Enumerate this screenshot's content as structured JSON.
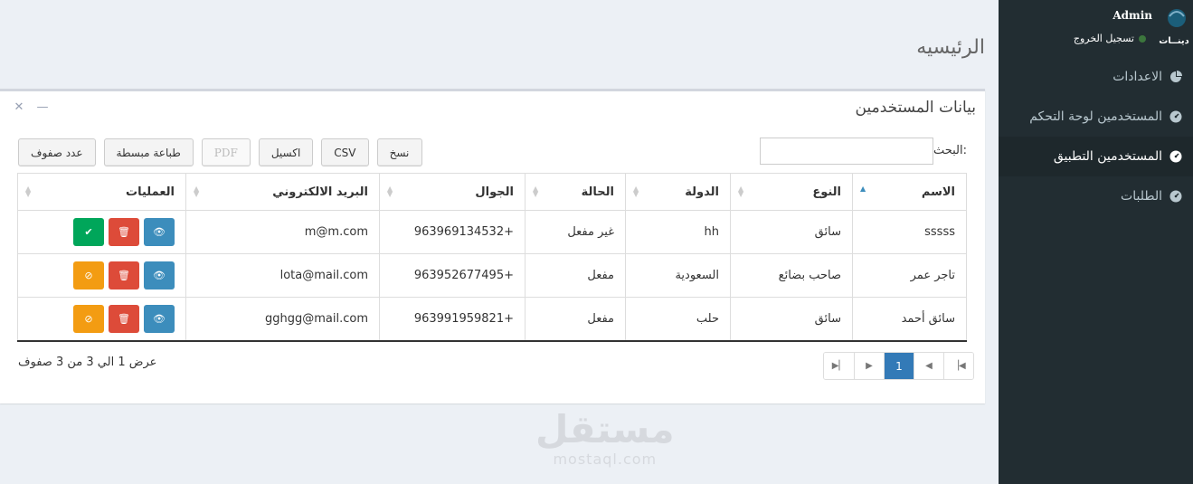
{
  "sidebar": {
    "user_name": "Admin",
    "logout_label": "تسجيل الخروج",
    "logo_text": "دينــات",
    "items": [
      {
        "label": "الاعدادات",
        "icon": "pie-chart-icon",
        "active": false
      },
      {
        "label": "المستخدمين لوحة التحكم",
        "icon": "dashboard-icon",
        "active": false
      },
      {
        "label": "المستخدمين التطبيق",
        "icon": "dashboard-icon",
        "active": true
      },
      {
        "label": "الطلبات",
        "icon": "dashboard-icon",
        "active": false
      }
    ]
  },
  "page": {
    "title": "الرئيسيه"
  },
  "box": {
    "title": "بيانات المستخدمين",
    "search_label": "البحث:",
    "buttons": {
      "copy": "نسخ",
      "csv": "CSV",
      "excel": "اكسيل",
      "pdf": "PDF",
      "print": "طباعة مبسطة",
      "rows": "عدد صفوف"
    },
    "columns": {
      "name": "الاسم",
      "type": "النوع",
      "country": "الدولة",
      "status": "الحالة",
      "mobile": "الجوال",
      "email": "البريد الالكتروني",
      "actions": "العمليات"
    },
    "rows": [
      {
        "name": "sssss",
        "type": "سائق",
        "country": "hh",
        "status": "غير مفعل",
        "mobile": "963969134532+",
        "email": "m@m.com"
      },
      {
        "name": "تاجر عمر",
        "type": "صاحب بضائع",
        "country": "السعودية",
        "status": "مفعل",
        "mobile": "963952677495+",
        "email": "lota@mail.com"
      },
      {
        "name": "سائق أحمد",
        "type": "سائق",
        "country": "حلب",
        "status": "مفعل",
        "mobile": "963991959821+",
        "email": "gghgg@mail.com"
      }
    ],
    "info": "عرض 1 الي 3 من 3 صفوف",
    "pagination": {
      "current": "1"
    }
  },
  "watermark": {
    "arabic": "مستقل",
    "latin": "mostaql.com"
  },
  "colors": {
    "sidebar": "#222d32",
    "primary": "#3c8dbc",
    "danger": "#dd4b39",
    "success": "#00a65a",
    "warning": "#f39c12"
  }
}
